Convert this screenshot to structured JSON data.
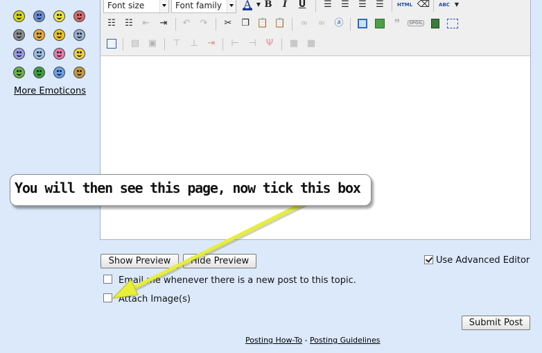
{
  "emoticons": {
    "rows": [
      [
        "smile-icon",
        "frown-blue-icon",
        "grin-icon",
        "angry-icon"
      ],
      [
        "cool-icon",
        "wink-icon",
        "laugh-icon",
        "dizzy-icon"
      ],
      [
        "sad-icon",
        "blush-icon",
        "embarrassed-icon",
        "shocked-icon"
      ],
      [
        "sick-icon",
        "tongue-icon",
        "cry-icon",
        "confused-icon"
      ]
    ],
    "colors": [
      [
        "#d6d61a",
        "#6b8fd6",
        "#e8e24a",
        "#d66b6b"
      ],
      [
        "#8a8a8a",
        "#e8a83a",
        "#f0c020",
        "#9ab0d0"
      ],
      [
        "#9a9ae8",
        "#9ac0e8",
        "#e87aa8",
        "#f0d040"
      ],
      [
        "#6ab04a",
        "#40a040",
        "#6aa0e8",
        "#c89a3a"
      ]
    ],
    "more_label": "More Emoticons"
  },
  "toolbar": {
    "font_size_label": "Font size",
    "font_family_label": "Font family",
    "font_color_glyph": "A",
    "bold_glyph": "B",
    "italic_glyph": "I",
    "underline_glyph": "U",
    "html_glyph": "HTML",
    "spoiler_glyph": "SPOIL",
    "abc_glyph": "ABC"
  },
  "callout": {
    "text": "You will then see this page, now tick this box"
  },
  "buttons": {
    "show_preview": "Show Preview",
    "hide_preview": "Hide Preview",
    "submit_post": "Submit Post"
  },
  "options": {
    "use_advanced_editor": {
      "label": "Use Advanced Editor",
      "checked": true
    },
    "email_notify": {
      "label": "Email me whenever there is a new post to this topic.",
      "checked": false
    },
    "attach_images": {
      "label": "Attach Image(s)",
      "checked": false
    }
  },
  "footer": {
    "link1": "Posting How-To",
    "separator": "-",
    "link2": "Posting Guidelines"
  },
  "colors": {
    "page_bg": "#dbe9fb",
    "arrow": "#e8ee3a"
  }
}
